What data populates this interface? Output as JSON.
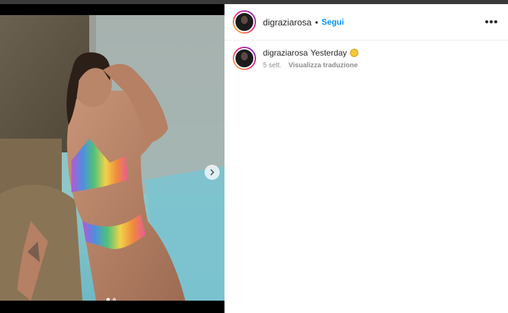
{
  "post": {
    "author": "digraziarosa",
    "separator": "•",
    "follow_label": "Segui",
    "more_label": "•••",
    "caption_user": "digraziarosa",
    "caption_text": "Yesterday",
    "caption_emoji": "yellow-heart-emoji",
    "time_ago": "5 sett.",
    "translate_label": "Visualizza traduzione",
    "carousel": {
      "slides": 2,
      "active_index": 0
    }
  },
  "colors": {
    "follow": "#0095f6",
    "muted": "#8e8e8e",
    "text": "#262626",
    "backdrop": "#000000"
  },
  "icons": {
    "next": "chevron-right-icon",
    "more": "more-horizontal-icon"
  }
}
